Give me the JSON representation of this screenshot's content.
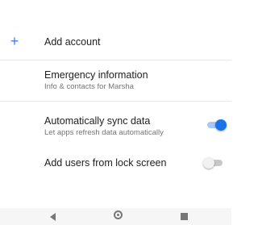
{
  "settings": {
    "add_account": {
      "label": "Add account",
      "icon": "plus-icon"
    },
    "emergency": {
      "title": "Emergency information",
      "subtitle": "Info & contacts for Marsha"
    },
    "auto_sync": {
      "title": "Automatically sync data",
      "subtitle": "Let apps refresh data automatically",
      "enabled": true
    },
    "lock_screen_users": {
      "title": "Add users from lock screen",
      "enabled": false
    }
  },
  "colors": {
    "accent": "#1a73e8",
    "plus": "#3d82f4"
  },
  "navbar": {
    "back": "back-icon",
    "home": "home-icon",
    "recents": "recents-icon"
  }
}
